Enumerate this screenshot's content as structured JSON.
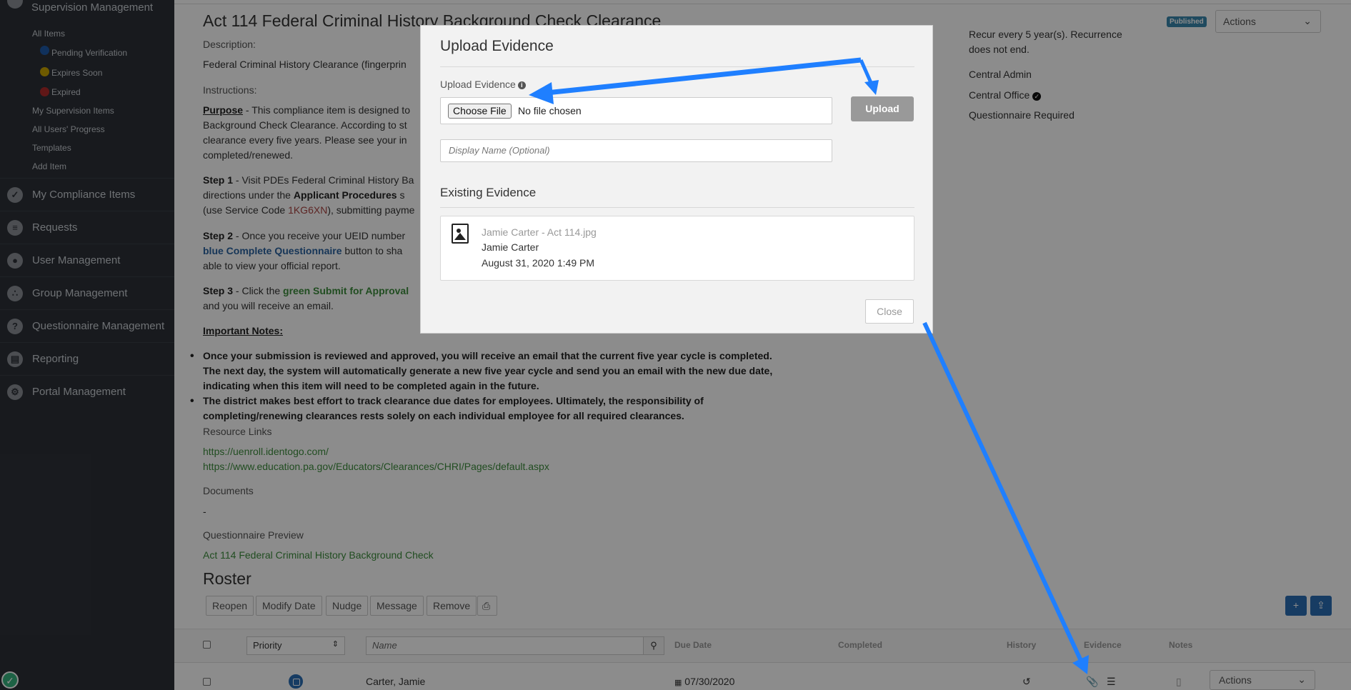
{
  "sidebar": {
    "header_label": "Supervision Management",
    "sub_items": [
      "All Items",
      "My Supervision Items",
      "All Users' Progress",
      "Templates",
      "Add Item"
    ],
    "status_items": [
      {
        "label": "Pending Verification",
        "color": "#1e5aa8"
      },
      {
        "label": "Expires Soon",
        "color": "#c9a400"
      },
      {
        "label": "Expired",
        "color": "#b02a2a"
      }
    ],
    "sections": [
      {
        "label": "My Compliance Items",
        "icon": "check-circle-icon"
      },
      {
        "label": "Requests",
        "icon": "document-icon"
      },
      {
        "label": "User Management",
        "icon": "user-icon"
      },
      {
        "label": "Group Management",
        "icon": "group-icon"
      },
      {
        "label": "Questionnaire Management",
        "icon": "question-icon"
      },
      {
        "label": "Reporting",
        "icon": "chart-icon"
      },
      {
        "label": "Portal Management",
        "icon": "gear-icon"
      }
    ]
  },
  "page": {
    "title": "Act 114 Federal Criminal History Background Check Clearance",
    "status_badge": "Published",
    "actions_label": "Actions",
    "description_label": "Description:",
    "description": "Federal Criminal History Clearance (fingerprin",
    "instructions_label": "Instructions:",
    "purpose_heading": "Purpose",
    "purpose_lines": [
      " - This compliance item is designed to",
      "Background Check Clearance.  According to st",
      "clearance every five years.  Please see your in",
      "completed/renewed."
    ],
    "step1_heading": "Step 1",
    "step1_line1": " - Visit PDEs Federal Criminal History Ba",
    "step1_line2_a": "directions under the ",
    "step1_line2_b": "Applicant Procedures",
    "step1_line2_c": " s",
    "step1_line3_a": "(use Service Code ",
    "step1_line3_code": "1KG6XN",
    "step1_line3_b": "), submitting payme",
    "step2_heading": "Step 2",
    "step2_line1": " - Once you receive your UEID number",
    "step2_line2_a": "blue Complete Questionnaire",
    "step2_line2_b": " button to sha",
    "step2_line3": "able to view your official report.",
    "step3_heading": "Step 3",
    "step3_line1_a": " - Click the ",
    "step3_line1_b": "green Submit for Approval",
    "step3_line2": "and you will receive an email.",
    "notes_heading": "Important Notes:",
    "notes": [
      "Once your submission is reviewed and approved, you will receive an email that the current five year cycle is completed. The next day, the system will automatically generate a new five year cycle and send you an email with the new due date, indicating when this item will need to be completed again in the future.",
      "The district makes best effort to track clearance due dates for employees. Ultimately, the responsibility of completing/renewing clearances rests solely on each individual employee for all required clearances."
    ],
    "resource_links_label": "Resource Links",
    "resource_links": [
      "https://uenroll.identogo.com/",
      "https://www.education.pa.gov/Educators/Clearances/CHRI/Pages/default.aspx"
    ],
    "documents_label": "Documents",
    "documents_value": "-",
    "questionnaire_preview_label": "Questionnaire Preview",
    "questionnaire_preview_link": "Act 114 Federal Criminal History Background Check",
    "right_recur_1": "Recur every 5 year(s). Recurrence",
    "right_recur_2": "does not end.",
    "right_owner": "Central Admin",
    "right_group": "Central Office",
    "right_questionnaire": "Questionnaire Required"
  },
  "roster": {
    "title": "Roster",
    "buttons": [
      "Reopen",
      "Modify Date",
      "Nudge",
      "Message",
      "Remove"
    ],
    "priority_label": "Priority",
    "name_placeholder": "Name",
    "columns": {
      "due_date": "Due Date",
      "completed": "Completed",
      "history": "History",
      "evidence": "Evidence",
      "notes": "Notes"
    },
    "row": {
      "name": "Carter, Jamie",
      "due_date": "07/30/2020",
      "actions": "Actions"
    }
  },
  "modal": {
    "title": "Upload Evidence",
    "upload_label": "Upload Evidence",
    "choose_file": "Choose File",
    "no_file": "No file chosen",
    "upload_button": "Upload",
    "display_name_placeholder": "Display Name (Optional)",
    "existing_heading": "Existing Evidence",
    "evidence": {
      "file_name": "Jamie Carter - Act 114.jpg",
      "user": "Jamie Carter",
      "date": "August 31, 2020 1:49 PM"
    },
    "close_button": "Close"
  },
  "colors": {
    "sidebar_bg": "#2d3138",
    "accent_blue": "#2a6db5",
    "arrow_blue": "#1f7fff",
    "link_green": "#3c8d3c"
  }
}
